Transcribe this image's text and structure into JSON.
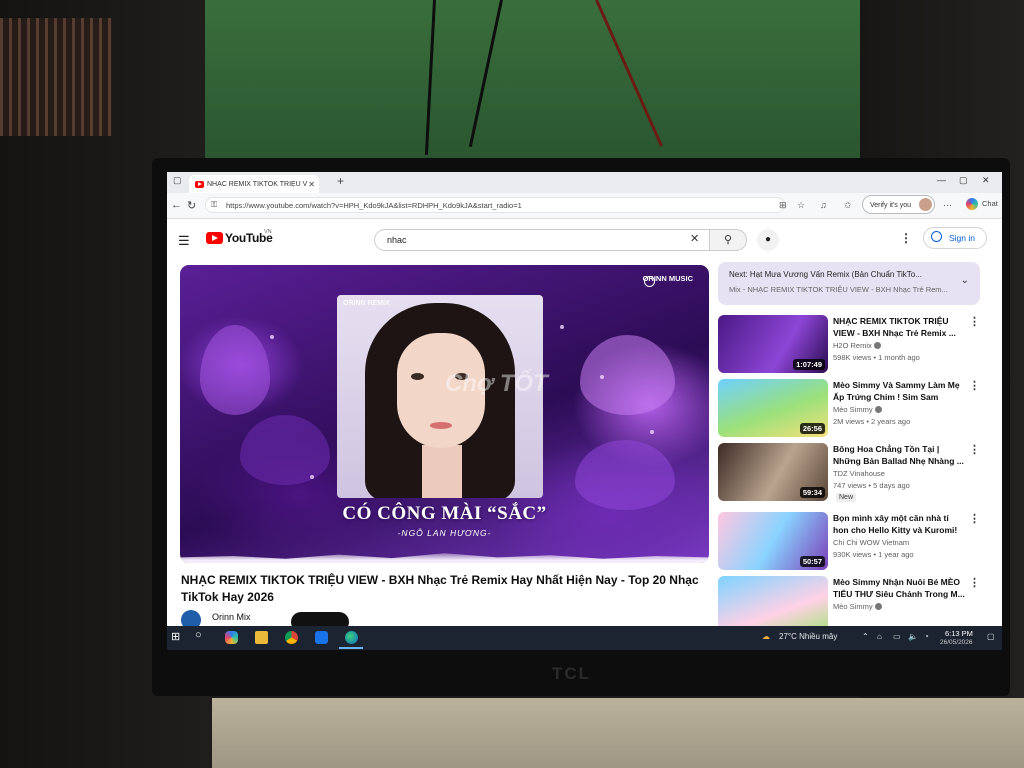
{
  "browser": {
    "tab_title": "NHẠC REMIX TIKTOK TRIỆU V",
    "tab_close": "✕",
    "new_tab": "+",
    "url": "https://www.youtube.com/watch?v=HPH_Kdo9kJA&list=RDHPH_Kdo9kJA&start_radio=1",
    "profile_label": "Verify it's you",
    "chat_label": "Chat"
  },
  "youtube": {
    "logo_text": "YouTube",
    "country_code": "VN",
    "search_value": "nhac",
    "sign_in": "Sign in"
  },
  "player": {
    "channel_badge": "ORINN REMIX",
    "brand": "ORINN MUSIC",
    "song_title": "CÓ CÔNG MÀI “SẮC”",
    "singer": "-NGÔ LAN HƯƠNG-",
    "watermark": "Chợ TỐT"
  },
  "video": {
    "title": "NHẠC REMIX TIKTOK TRIỆU VIEW - BXH Nhạc Trẻ Remix Hay Nhất Hiện Nay - Top 20 Nhạc TikTok Hay 2026",
    "channel": "Orinn Mix"
  },
  "up_next": {
    "label": "Next: Hạt Mưa Vương Vấn Remix (Bản Chuẩn TikTo...",
    "playlist": "Mix - NHẠC REMIX TIKTOK TRIỆU VIEW - BXH Nhạc Trẻ Rem..."
  },
  "recommendations": [
    {
      "title": "NHẠC REMIX TIKTOK TRIỆU VIEW - BXH Nhạc Trẻ Remix ...",
      "channel": "H2O Remix",
      "meta": "598K views • 1 month ago",
      "duration": "1:07:49",
      "badge": ""
    },
    {
      "title": "Mèo Simmy Và Sammy Làm Mẹ Ấp Trứng Chim ! Sim Sam Làm...",
      "channel": "Mèo Simmy",
      "meta": "2M views • 2 years ago",
      "duration": "26:56",
      "badge": ""
    },
    {
      "title": "Bông Hoa Chẳng Tồn Tại | Những Bản Ballad Nhẹ Nhàng ...",
      "channel": "TDZ Vinahouse",
      "meta": "747 views • 5 days ago",
      "duration": "59:34",
      "badge": "New"
    },
    {
      "title": "Bọn mình xây một căn nhà tí hon cho Hello Kitty và Kuromi!",
      "channel": "Chi Chi WOW Vietnam",
      "meta": "930K views • 1 year ago",
      "duration": "50:57",
      "badge": ""
    },
    {
      "title": "Mèo Simmy Nhận Nuôi Bé MÈO TIỂU THƯ Siêu Chảnh Trong M...",
      "channel": "Mèo Simmy",
      "meta": "",
      "duration": "",
      "badge": ""
    }
  ],
  "taskbar": {
    "weather": "27°C  Nhiều mây",
    "time": "6:13 PM",
    "date": "26/05/2026"
  },
  "icons": {
    "back": "←",
    "refresh": "↻",
    "search": "⚲",
    "mic": "🎙",
    "more": "⋮",
    "chevron": "⌄"
  },
  "colors": {
    "youtube_red": "#ff0000",
    "sign_in_blue": "#065fd4",
    "taskbar": "#1b2430"
  }
}
